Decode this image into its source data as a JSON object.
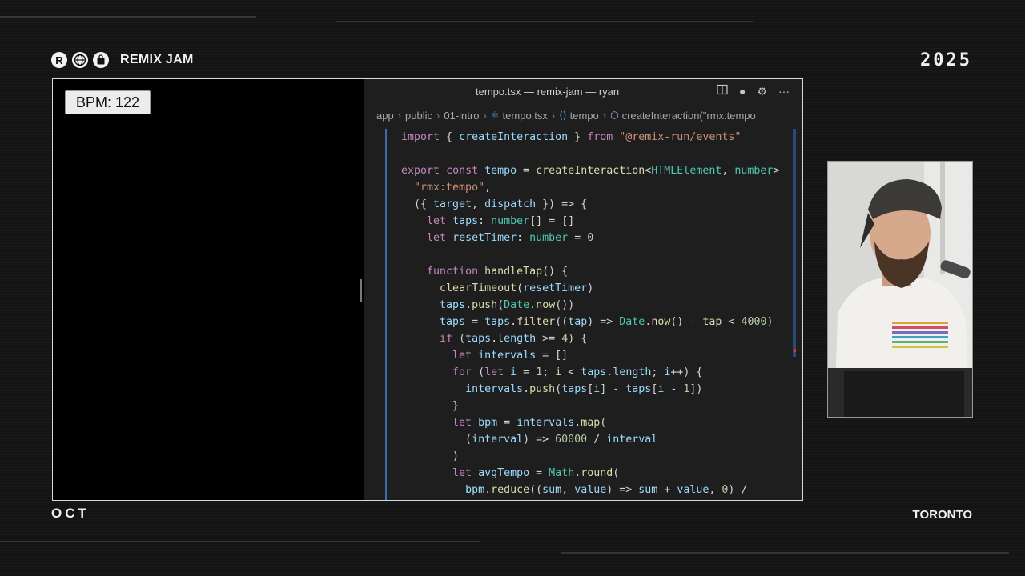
{
  "event": {
    "brand_name": "REMIX JAM",
    "year": "2025",
    "month": "OCT",
    "city": "TORONTO",
    "logo_icons": [
      "remix-r-icon",
      "globe-icon",
      "shopify-bag-icon"
    ]
  },
  "app": {
    "bpm_label": "BPM: 122"
  },
  "editor": {
    "window_title": "tempo.tsx — remix-jam — ryan",
    "title_icons": [
      "split-editor-icon",
      "unsaved-dot-icon",
      "gear-icon",
      "more-icon"
    ],
    "breadcrumbs": [
      "app",
      "public",
      "01-intro",
      "tempo.tsx",
      "tempo",
      "createInteraction(\"rmx:tempo"
    ],
    "code_lines": [
      "import { createInteraction } from \"@remix-run/events\"",
      "",
      "export const tempo = createInteraction<HTMLElement, number>",
      "  \"rmx:tempo\",",
      "  ({ target, dispatch }) => {",
      "    let taps: number[] = []",
      "    let resetTimer: number = 0",
      "",
      "    function handleTap() {",
      "      clearTimeout(resetTimer)",
      "      taps.push(Date.now())",
      "      taps = taps.filter((tap) => Date.now() - tap < 4000)",
      "      if (taps.length >= 4) {",
      "        let intervals = []",
      "        for (let i = 1; i < taps.length; i++) {",
      "          intervals.push(taps[i] - taps[i - 1])",
      "        }",
      "        let bpm = intervals.map(",
      "          (interval) => 60000 / interval",
      "        )",
      "        let avgTempo = Math.round(",
      "          bpm.reduce((sum, value) => sum + value, 0) /"
    ]
  },
  "colors": {
    "background": "#141414",
    "editor_bg": "#1e1e1e",
    "keyword": "#c586c0",
    "string": "#ce9178",
    "function": "#dcdcaa",
    "variable": "#9cdcfe",
    "type": "#4ec9b0",
    "number": "#b5cea8"
  }
}
